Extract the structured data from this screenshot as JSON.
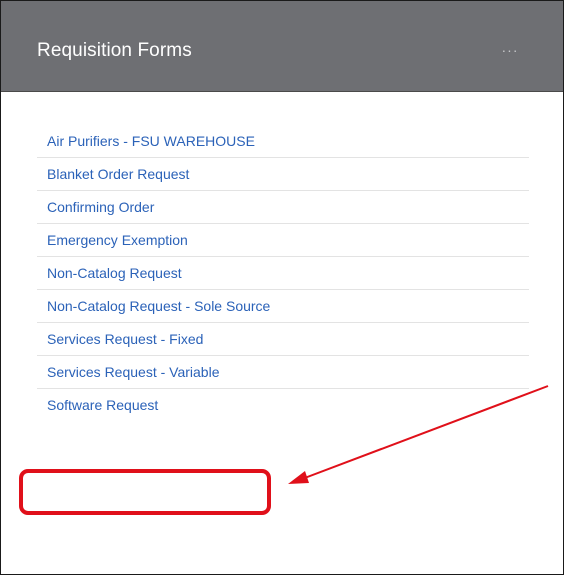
{
  "panel": {
    "title": "Requisition Forms",
    "menu_icon": "ellipsis-icon",
    "menu_glyph": "···"
  },
  "forms": [
    {
      "label": "Air Purifiers - FSU WAREHOUSE"
    },
    {
      "label": "Blanket Order Request"
    },
    {
      "label": "Confirming Order"
    },
    {
      "label": "Emergency Exemption"
    },
    {
      "label": "Non-Catalog Request"
    },
    {
      "label": "Non-Catalog Request - Sole Source"
    },
    {
      "label": "Services Request - Fixed"
    },
    {
      "label": "Services Request - Variable"
    },
    {
      "label": "Software Request"
    }
  ],
  "annotation": {
    "highlighted_item": "Software Request",
    "color": "#e0101a"
  },
  "colors": {
    "header_bg": "#6e6f73",
    "link": "#2b62b8",
    "divider": "#e3e3e3"
  }
}
